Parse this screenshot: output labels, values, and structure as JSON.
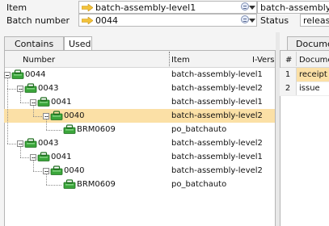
{
  "top": {
    "item_label": "Item",
    "item_value": "batch-assembly-level1",
    "batch_label": "Batch number",
    "batch_value": "0044",
    "right_item_value": "batch-assembly-level1",
    "status_label": "Status",
    "status_value": "released"
  },
  "tabs": {
    "contains": "Contains",
    "used_in": "Used in"
  },
  "tree": {
    "columns": {
      "number": "Number",
      "item": "Item",
      "iversion": "I-Version"
    },
    "rows": [
      {
        "number": "0044",
        "item": "batch-assembly-level1",
        "level": 0,
        "selected": false
      },
      {
        "number": "0043",
        "item": "batch-assembly-level2",
        "level": 1,
        "selected": false
      },
      {
        "number": "0041",
        "item": "batch-assembly-level1",
        "level": 2,
        "selected": false
      },
      {
        "number": "0040",
        "item": "batch-assembly-level2",
        "level": 3,
        "selected": true
      },
      {
        "number": "BRM0609",
        "item": "po_batchauto",
        "level": 4,
        "selected": false
      },
      {
        "number": "0043",
        "item": "batch-assembly-level2",
        "level": 1,
        "selected": false
      },
      {
        "number": "0041",
        "item": "batch-assembly-level1",
        "level": 2,
        "selected": false
      },
      {
        "number": "0040",
        "item": "batch-assembly-level2",
        "level": 3,
        "selected": false
      },
      {
        "number": "BRM0609",
        "item": "po_batchauto",
        "level": 4,
        "selected": false
      }
    ]
  },
  "documents": {
    "tab_label": "Documents",
    "col_num": "#",
    "col_doc": "Document",
    "rows": [
      {
        "n": "1",
        "doc": "receipt",
        "selected": true
      },
      {
        "n": "2",
        "doc": "issue",
        "selected": false
      }
    ]
  },
  "colors": {
    "selection": "#fbe0a6",
    "node_green": "#3aa53a",
    "arrow_yellow": "#f2c23b"
  }
}
